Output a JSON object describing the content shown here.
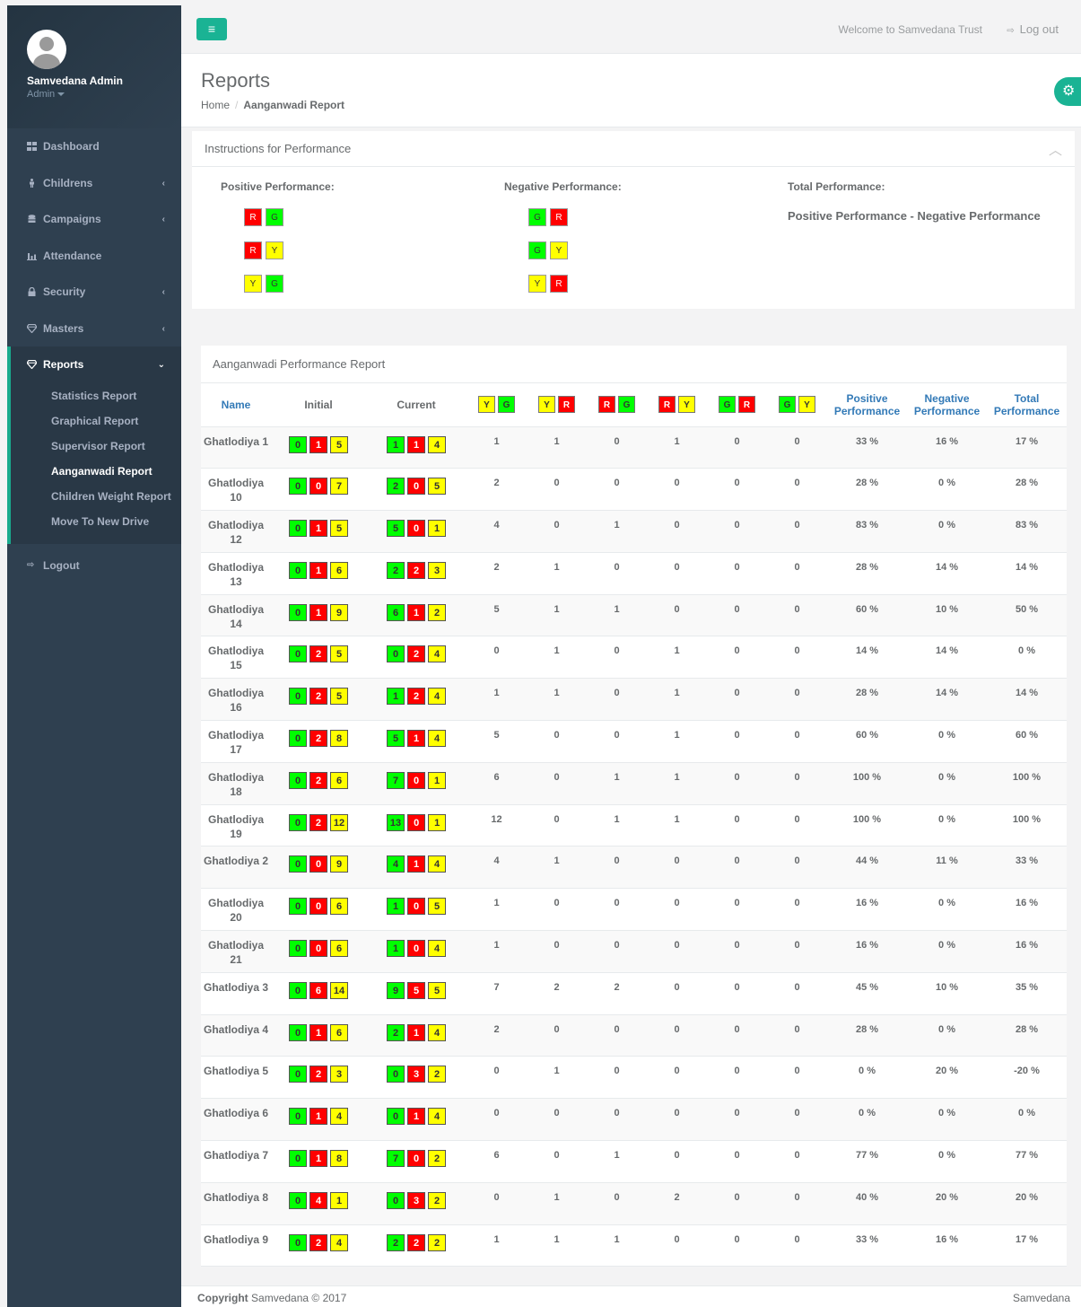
{
  "profile": {
    "name": "Samvedana Admin",
    "role": "Admin"
  },
  "sidebar": {
    "items": [
      {
        "label": "Dashboard",
        "icon": "th-large-icon",
        "chevron": false
      },
      {
        "label": "Childrens",
        "icon": "child-icon",
        "chevron": true
      },
      {
        "label": "Campaigns",
        "icon": "database-icon",
        "chevron": true
      },
      {
        "label": "Attendance",
        "icon": "bar-chart-icon",
        "chevron": false
      },
      {
        "label": "Security",
        "icon": "lock-icon",
        "chevron": true
      },
      {
        "label": "Masters",
        "icon": "diamond-icon",
        "chevron": true
      },
      {
        "label": "Reports",
        "icon": "diamond-icon",
        "chevron": true
      }
    ],
    "reports_sub": [
      "Statistics Report",
      "Graphical Report",
      "Supervisor Report",
      "Aanganwadi Report",
      "Children Weight Report",
      "Move To New Drive"
    ],
    "logout": "Logout"
  },
  "topbar": {
    "welcome": "Welcome to Samvedana Trust",
    "logout": "Log out",
    "accent": "#1ab394"
  },
  "page": {
    "title": "Reports",
    "breadcrumb_home": "Home",
    "breadcrumb_current": "Aanganwadi Report"
  },
  "instructions": {
    "title": "Instructions for Performance",
    "positive_label": "Positive Performance:",
    "negative_label": "Negative Performance:",
    "total_label": "Total Performance:",
    "total_formula": "Positive Performance - Negative Performance",
    "positive_pairs": [
      [
        "R",
        "G"
      ],
      [
        "R",
        "Y"
      ],
      [
        "Y",
        "G"
      ]
    ],
    "negative_pairs": [
      [
        "G",
        "R"
      ],
      [
        "G",
        "Y"
      ],
      [
        "Y",
        "R"
      ]
    ]
  },
  "report": {
    "title": "Aanganwadi Performance Report",
    "headers": {
      "name": "Name",
      "initial": "Initial",
      "current": "Current",
      "positive": "Positive Performance",
      "negative": "Negative Performance",
      "total": "Total Performance"
    },
    "transition_headers": [
      [
        "Y",
        "G"
      ],
      [
        "Y",
        "R"
      ],
      [
        "R",
        "G"
      ],
      [
        "R",
        "Y"
      ],
      [
        "G",
        "R"
      ],
      [
        "G",
        "Y"
      ]
    ],
    "rows": [
      {
        "name": "Ghatlodiya 1",
        "initial": [
          "0",
          "1",
          "5"
        ],
        "current": [
          "1",
          "1",
          "4"
        ],
        "t": [
          "1",
          "1",
          "0",
          "1",
          "0",
          "0"
        ],
        "pos": "33 %",
        "neg": "16 %",
        "tot": "17 %"
      },
      {
        "name": "Ghatlodiya 10",
        "initial": [
          "0",
          "0",
          "7"
        ],
        "current": [
          "2",
          "0",
          "5"
        ],
        "t": [
          "2",
          "0",
          "0",
          "0",
          "0",
          "0"
        ],
        "pos": "28 %",
        "neg": "0 %",
        "tot": "28 %"
      },
      {
        "name": "Ghatlodiya 12",
        "initial": [
          "0",
          "1",
          "5"
        ],
        "current": [
          "5",
          "0",
          "1"
        ],
        "t": [
          "4",
          "0",
          "1",
          "0",
          "0",
          "0"
        ],
        "pos": "83 %",
        "neg": "0 %",
        "tot": "83 %"
      },
      {
        "name": "Ghatlodiya 13",
        "initial": [
          "0",
          "1",
          "6"
        ],
        "current": [
          "2",
          "2",
          "3"
        ],
        "t": [
          "2",
          "1",
          "0",
          "0",
          "0",
          "0"
        ],
        "pos": "28 %",
        "neg": "14 %",
        "tot": "14 %"
      },
      {
        "name": "Ghatlodiya 14",
        "initial": [
          "0",
          "1",
          "9"
        ],
        "current": [
          "6",
          "1",
          "2"
        ],
        "t": [
          "5",
          "1",
          "1",
          "0",
          "0",
          "0"
        ],
        "pos": "60 %",
        "neg": "10 %",
        "tot": "50 %"
      },
      {
        "name": "Ghatlodiya 15",
        "initial": [
          "0",
          "2",
          "5"
        ],
        "current": [
          "0",
          "2",
          "4"
        ],
        "t": [
          "0",
          "1",
          "0",
          "1",
          "0",
          "0"
        ],
        "pos": "14 %",
        "neg": "14 %",
        "tot": "0 %"
      },
      {
        "name": "Ghatlodiya 16",
        "initial": [
          "0",
          "2",
          "5"
        ],
        "current": [
          "1",
          "2",
          "4"
        ],
        "t": [
          "1",
          "1",
          "0",
          "1",
          "0",
          "0"
        ],
        "pos": "28 %",
        "neg": "14 %",
        "tot": "14 %"
      },
      {
        "name": "Ghatlodiya 17",
        "initial": [
          "0",
          "2",
          "8"
        ],
        "current": [
          "5",
          "1",
          "4"
        ],
        "t": [
          "5",
          "0",
          "0",
          "1",
          "0",
          "0"
        ],
        "pos": "60 %",
        "neg": "0 %",
        "tot": "60 %"
      },
      {
        "name": "Ghatlodiya 18",
        "initial": [
          "0",
          "2",
          "6"
        ],
        "current": [
          "7",
          "0",
          "1"
        ],
        "t": [
          "6",
          "0",
          "1",
          "1",
          "0",
          "0"
        ],
        "pos": "100 %",
        "neg": "0 %",
        "tot": "100 %"
      },
      {
        "name": "Ghatlodiya 19",
        "initial": [
          "0",
          "2",
          "12"
        ],
        "current": [
          "13",
          "0",
          "1"
        ],
        "t": [
          "12",
          "0",
          "1",
          "1",
          "0",
          "0"
        ],
        "pos": "100 %",
        "neg": "0 %",
        "tot": "100 %"
      },
      {
        "name": "Ghatlodiya 2",
        "initial": [
          "0",
          "0",
          "9"
        ],
        "current": [
          "4",
          "1",
          "4"
        ],
        "t": [
          "4",
          "1",
          "0",
          "0",
          "0",
          "0"
        ],
        "pos": "44 %",
        "neg": "11 %",
        "tot": "33 %"
      },
      {
        "name": "Ghatlodiya 20",
        "initial": [
          "0",
          "0",
          "6"
        ],
        "current": [
          "1",
          "0",
          "5"
        ],
        "t": [
          "1",
          "0",
          "0",
          "0",
          "0",
          "0"
        ],
        "pos": "16 %",
        "neg": "0 %",
        "tot": "16 %"
      },
      {
        "name": "Ghatlodiya 21",
        "initial": [
          "0",
          "0",
          "6"
        ],
        "current": [
          "1",
          "0",
          "4"
        ],
        "t": [
          "1",
          "0",
          "0",
          "0",
          "0",
          "0"
        ],
        "pos": "16 %",
        "neg": "0 %",
        "tot": "16 %"
      },
      {
        "name": "Ghatlodiya 3",
        "initial": [
          "0",
          "6",
          "14"
        ],
        "current": [
          "9",
          "5",
          "5"
        ],
        "t": [
          "7",
          "2",
          "2",
          "0",
          "0",
          "0"
        ],
        "pos": "45 %",
        "neg": "10 %",
        "tot": "35 %"
      },
      {
        "name": "Ghatlodiya 4",
        "initial": [
          "0",
          "1",
          "6"
        ],
        "current": [
          "2",
          "1",
          "4"
        ],
        "t": [
          "2",
          "0",
          "0",
          "0",
          "0",
          "0"
        ],
        "pos": "28 %",
        "neg": "0 %",
        "tot": "28 %"
      },
      {
        "name": "Ghatlodiya 5",
        "initial": [
          "0",
          "2",
          "3"
        ],
        "current": [
          "0",
          "3",
          "2"
        ],
        "t": [
          "0",
          "1",
          "0",
          "0",
          "0",
          "0"
        ],
        "pos": "0 %",
        "neg": "20 %",
        "tot": "-20 %"
      },
      {
        "name": "Ghatlodiya 6",
        "initial": [
          "0",
          "1",
          "4"
        ],
        "current": [
          "0",
          "1",
          "4"
        ],
        "t": [
          "0",
          "0",
          "0",
          "0",
          "0",
          "0"
        ],
        "pos": "0 %",
        "neg": "0 %",
        "tot": "0 %"
      },
      {
        "name": "Ghatlodiya 7",
        "initial": [
          "0",
          "1",
          "8"
        ],
        "current": [
          "7",
          "0",
          "2"
        ],
        "t": [
          "6",
          "0",
          "1",
          "0",
          "0",
          "0"
        ],
        "pos": "77 %",
        "neg": "0 %",
        "tot": "77 %"
      },
      {
        "name": "Ghatlodiya 8",
        "initial": [
          "0",
          "4",
          "1"
        ],
        "current": [
          "0",
          "3",
          "2"
        ],
        "t": [
          "0",
          "1",
          "0",
          "2",
          "0",
          "0"
        ],
        "pos": "40 %",
        "neg": "20 %",
        "tot": "20 %"
      },
      {
        "name": "Ghatlodiya 9",
        "initial": [
          "0",
          "2",
          "4"
        ],
        "current": [
          "2",
          "2",
          "2"
        ],
        "t": [
          "1",
          "1",
          "1",
          "0",
          "0",
          "0"
        ],
        "pos": "33 %",
        "neg": "16 %",
        "tot": "17 %"
      }
    ]
  },
  "footer": {
    "copyright_bold": "Copyright",
    "copyright_rest": "Samvedana © 2017",
    "right": "Samvedana"
  },
  "colors": {
    "sidebar": "#2f4050",
    "green": "#00ff00",
    "red": "#ff0000",
    "yellow": "#ffff00",
    "link": "#337ab7"
  }
}
